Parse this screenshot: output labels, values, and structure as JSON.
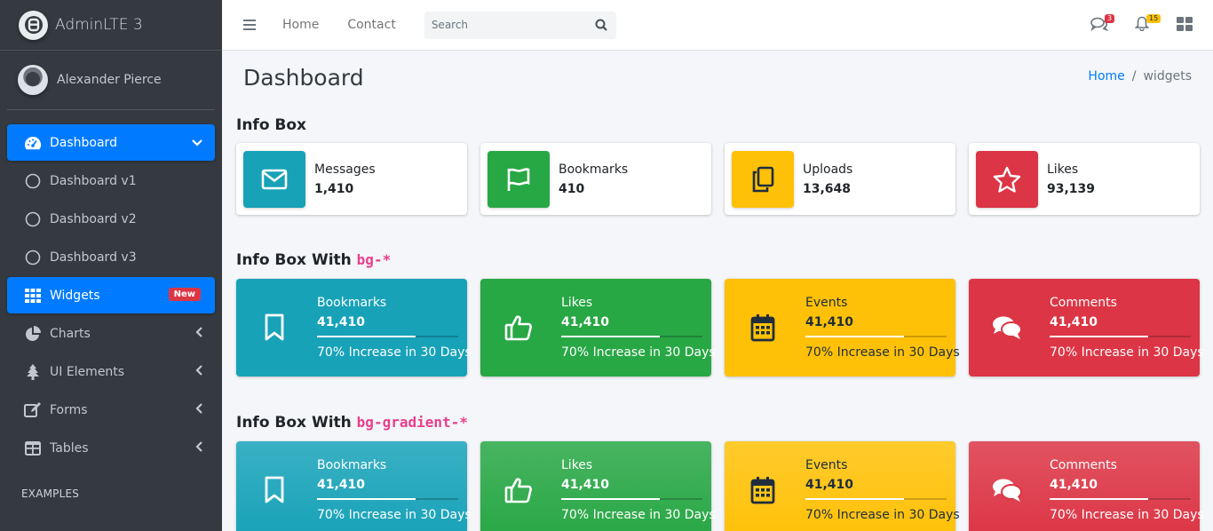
{
  "brand": {
    "name": "AdminLTE 3"
  },
  "user": {
    "name": "Alexander Pierce"
  },
  "sidebar": {
    "items": [
      {
        "label": "Dashboard",
        "icon": "tachometer-icon",
        "active": true
      },
      {
        "label": "Dashboard v1",
        "icon": "circle-icon"
      },
      {
        "label": "Dashboard v2",
        "icon": "circle-icon"
      },
      {
        "label": "Dashboard v3",
        "icon": "circle-icon"
      },
      {
        "label": "Widgets",
        "icon": "grid-icon",
        "active": true,
        "badge": "New"
      },
      {
        "label": "Charts",
        "icon": "pie-chart-icon"
      },
      {
        "label": "UI Elements",
        "icon": "tree-icon"
      },
      {
        "label": "Forms",
        "icon": "edit-icon"
      },
      {
        "label": "Tables",
        "icon": "table-icon"
      }
    ],
    "header": "EXAMPLES"
  },
  "topbar": {
    "links": [
      "Home",
      "Contact"
    ],
    "search_placeholder": "Search",
    "messages_count": "3",
    "notifications_count": "15"
  },
  "page": {
    "title": "Dashboard",
    "breadcrumb": [
      "Home",
      "widgets"
    ]
  },
  "sections": {
    "info_box": "Info Box",
    "bg_prefix": "Info Box With ",
    "bg_code": "bg-*",
    "gradient_prefix": "Info Box With ",
    "gradient_code": "bg-gradient-*"
  },
  "info_boxes": [
    {
      "label": "Messages",
      "value": "1,410",
      "icon": "envelope-icon",
      "color": "#17a2b8"
    },
    {
      "label": "Bookmarks",
      "value": "410",
      "icon": "flag-icon",
      "color": "#28a745"
    },
    {
      "label": "Uploads",
      "value": "13,648",
      "icon": "copy-icon",
      "color": "#ffc107"
    },
    {
      "label": "Likes",
      "value": "93,139",
      "icon": "star-icon",
      "color": "#dc3545"
    }
  ],
  "bg_boxes": [
    {
      "label": "Bookmarks",
      "value": "41,410",
      "progress": 0.7,
      "desc": "70% Increase in 30 Days",
      "icon": "bookmark-icon"
    },
    {
      "label": "Likes",
      "value": "41,410",
      "progress": 0.7,
      "desc": "70% Increase in 30 Days",
      "icon": "thumbs-up-icon"
    },
    {
      "label": "Events",
      "value": "41,410",
      "progress": 0.7,
      "desc": "70% Increase in 30 Days",
      "icon": "calendar-icon"
    },
    {
      "label": "Comments",
      "value": "41,410",
      "progress": 0.7,
      "desc": "70% Increase in 30 Days",
      "icon": "comments-icon"
    }
  ],
  "gradient_boxes": [
    {
      "label": "Bookmarks",
      "value": "41,410",
      "progress": 0.7,
      "desc": "70% Increase in 30 Days",
      "icon": "bookmark-icon"
    },
    {
      "label": "Likes",
      "value": "41,410",
      "progress": 0.7,
      "desc": "70% Increase in 30 Days",
      "icon": "thumbs-up-icon"
    },
    {
      "label": "Events",
      "value": "41,410",
      "progress": 0.7,
      "desc": "70% Increase in 30 Days",
      "icon": "calendar-icon"
    },
    {
      "label": "Comments",
      "value": "41,410",
      "progress": 0.7,
      "desc": "70% Increase in 30 Days",
      "icon": "comments-icon"
    }
  ]
}
